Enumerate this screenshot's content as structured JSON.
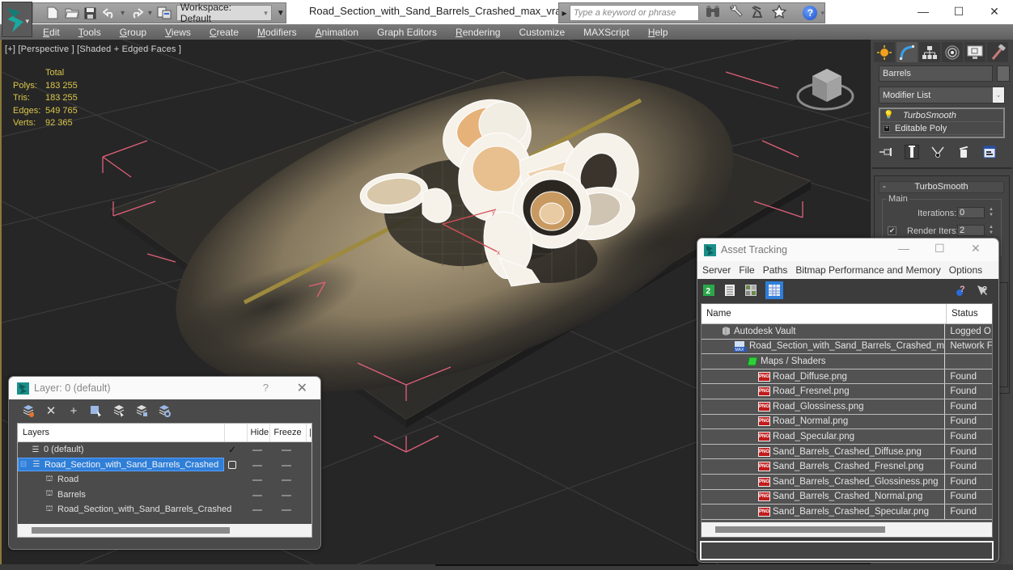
{
  "titlebar": {
    "workspace_label": "Workspace: Default",
    "document_title": "Road_Section_with_Sand_Barrels_Crashed_max_vray.max",
    "search_placeholder": "Type a keyword or phrase",
    "minimize": "—",
    "maximize": "☐",
    "close": "✕"
  },
  "menu": [
    {
      "label": "Edit",
      "mnemonic": "E",
      "rest": "dit"
    },
    {
      "label": "Tools",
      "mnemonic": "T",
      "rest": "ools"
    },
    {
      "label": "Group",
      "mnemonic": "G",
      "rest": "roup"
    },
    {
      "label": "Views",
      "mnemonic": "V",
      "rest": "iews"
    },
    {
      "label": "Create",
      "mnemonic": "C",
      "rest": "reate"
    },
    {
      "label": "Modifiers",
      "mnemonic": "M",
      "rest": "odifiers"
    },
    {
      "label": "Animation",
      "mnemonic": "A",
      "rest": "nimation"
    },
    {
      "label": "Graph Editors",
      "mnemonic": "",
      "rest": "Graph Editors"
    },
    {
      "label": "Rendering",
      "mnemonic": "R",
      "rest": "endering"
    },
    {
      "label": "Customize",
      "mnemonic": "",
      "rest": "Customize"
    },
    {
      "label": "MAXScript",
      "mnemonic": "",
      "rest": "MAXScript"
    },
    {
      "label": "Help",
      "mnemonic": "H",
      "rest": "elp"
    }
  ],
  "viewport": {
    "label": "[+] [Perspective ] [Shaded + Edged Faces ]",
    "stats": {
      "header": "Total",
      "rows": [
        {
          "key": "Polys:",
          "value": "183 255"
        },
        {
          "key": "Tris:",
          "value": "183 255"
        },
        {
          "key": "Edges:",
          "value": "549 765"
        },
        {
          "key": "Verts:",
          "value": "92 365"
        }
      ]
    }
  },
  "command_panel": {
    "object_name": "Barrels",
    "modifier_list": "Modifier List",
    "stack": [
      {
        "label": "TurboSmooth",
        "icon": "lightbulb-icon"
      },
      {
        "label": "Editable Poly",
        "icon": "plus-icon"
      }
    ],
    "rollout_title": "TurboSmooth",
    "rollout_toggle": "-",
    "group_main": "Main",
    "iterations_label": "Iterations:",
    "iterations_value": "0",
    "render_iters_label": "Render Iters:",
    "render_iters_value": "2",
    "render_iters_checked": "✔"
  },
  "layer_dialog": {
    "title": "Layer: 0 (default)",
    "help": "?",
    "close": "✕",
    "columns": [
      "Layers",
      "",
      "Hide",
      "Freeze",
      "R"
    ],
    "rows": [
      {
        "name": "0 (default)",
        "type": "layer",
        "indent": 1,
        "current": "✓"
      },
      {
        "name": "Road_Section_with_Sand_Barrels_Crashed",
        "type": "layer",
        "indent": 0,
        "selected": true,
        "expanded": "⊟"
      },
      {
        "name": "Road",
        "type": "object",
        "indent": 2
      },
      {
        "name": "Barrels",
        "type": "object",
        "indent": 2
      },
      {
        "name": "Road_Section_with_Sand_Barrels_Crashed",
        "type": "object",
        "indent": 2
      }
    ]
  },
  "asset_tracking": {
    "title": "Asset Tracking",
    "menu": [
      "Server",
      "File",
      "Paths",
      "Bitmap Performance and Memory",
      "Options"
    ],
    "columns": [
      "Name",
      "Status"
    ],
    "rows": [
      {
        "name": "Autodesk Vault",
        "status": "Logged O",
        "icon": "vault-icon",
        "indent": 1
      },
      {
        "name": "Road_Section_with_Sand_Barrels_Crashed_max...",
        "status": "Network F",
        "icon": "max-file-icon",
        "indent": 2
      },
      {
        "name": "Maps / Shaders",
        "status": "",
        "icon": "maps-folder-icon",
        "indent": 3
      },
      {
        "name": "Road_Diffuse.png",
        "status": "Found",
        "icon": "png-icon",
        "indent": 4
      },
      {
        "name": "Road_Fresnel.png",
        "status": "Found",
        "icon": "png-icon",
        "indent": 4
      },
      {
        "name": "Road_Glossiness.png",
        "status": "Found",
        "icon": "png-icon",
        "indent": 4
      },
      {
        "name": "Road_Normal.png",
        "status": "Found",
        "icon": "png-icon",
        "indent": 4
      },
      {
        "name": "Road_Specular.png",
        "status": "Found",
        "icon": "png-icon",
        "indent": 4
      },
      {
        "name": "Sand_Barrels_Crashed_Diffuse.png",
        "status": "Found",
        "icon": "png-icon",
        "indent": 4
      },
      {
        "name": "Sand_Barrels_Crashed_Fresnel.png",
        "status": "Found",
        "icon": "png-icon",
        "indent": 4
      },
      {
        "name": "Sand_Barrels_Crashed_Glossiness.png",
        "status": "Found",
        "icon": "png-icon",
        "indent": 4
      },
      {
        "name": "Sand_Barrels_Crashed_Normal.png",
        "status": "Found",
        "icon": "png-icon",
        "indent": 4
      },
      {
        "name": "Sand_Barrels_Crashed_Specular.png",
        "status": "Found",
        "icon": "png-icon",
        "indent": 4
      }
    ],
    "png_badge": "PNG",
    "max_badge": "MAX"
  },
  "colors": {
    "selection_blue": "#2f7fd9",
    "stats_yellow": "#d9c64a",
    "png_red": "#c21b1b",
    "bounding_box_pink": "#e0607a"
  }
}
